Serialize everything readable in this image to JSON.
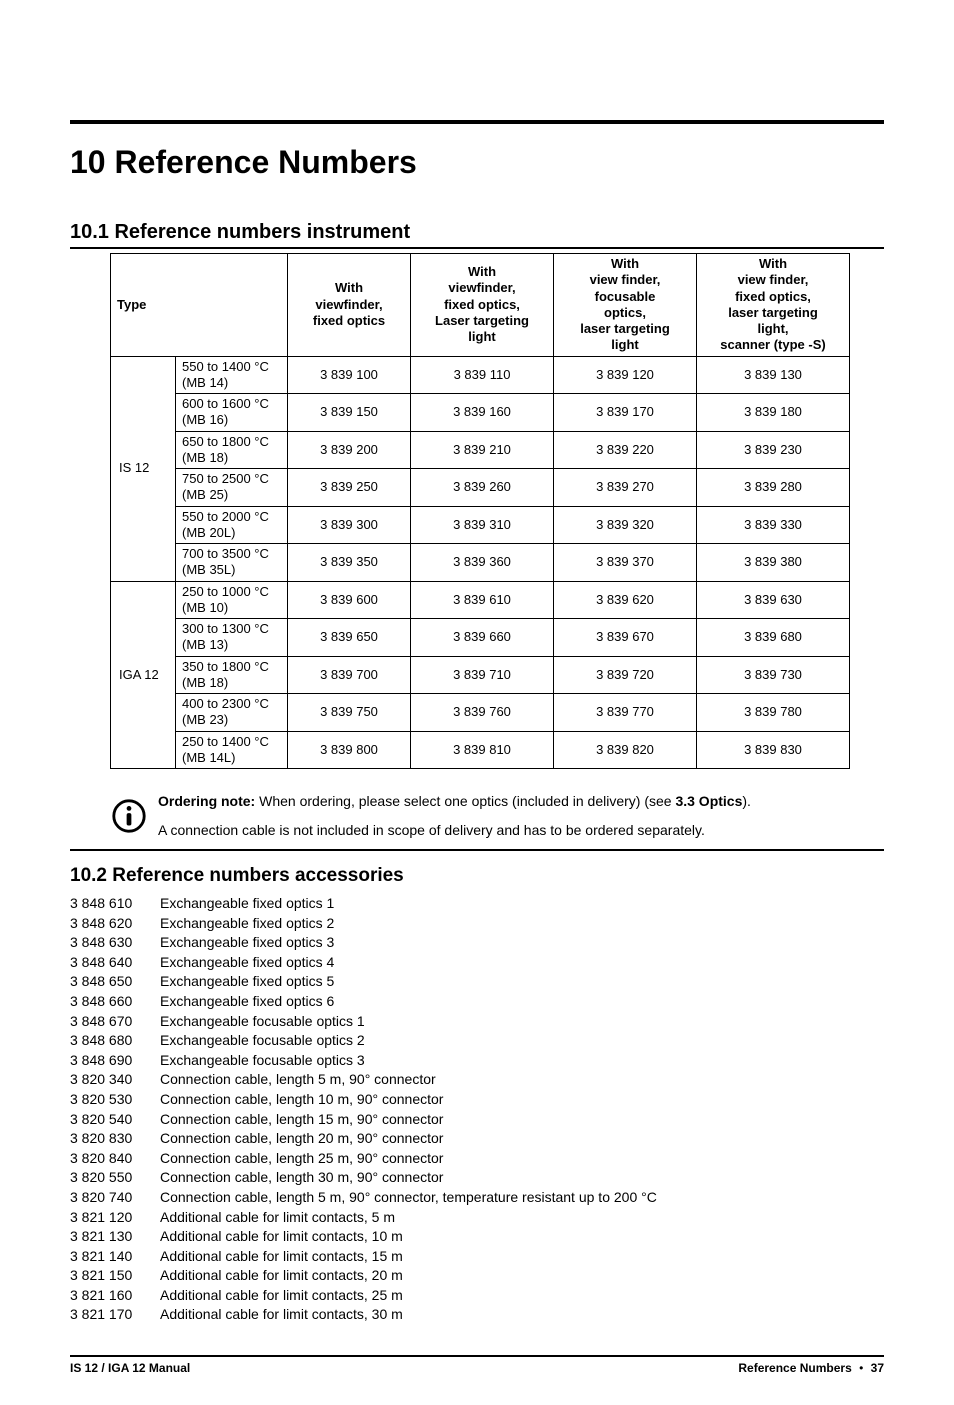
{
  "heading_main": "10  Reference Numbers",
  "section1_heading": "10.1  Reference numbers instrument",
  "table": {
    "headers": {
      "type": "Type",
      "col1": "With\nviewfinder,\nfixed optics",
      "col2": "With\nviewfinder,\nfixed optics,\nLaser targeting\nlight",
      "col3": "With\nview finder,\nfocusable\noptics,\nlaser targeting\nlight",
      "col4": "With\nview finder,\nfixed optics,\nlaser targeting\nlight,\nscanner (type -S)"
    },
    "groups": [
      {
        "label": "IS 12",
        "rows": [
          {
            "range": "550 to 1400 °C (MB 14)",
            "c1": "3 839 100",
            "c2": "3 839 110",
            "c3": "3 839 120",
            "c4": "3 839 130"
          },
          {
            "range": "600 to 1600 °C (MB 16)",
            "c1": "3 839 150",
            "c2": "3 839 160",
            "c3": "3 839 170",
            "c4": "3 839 180"
          },
          {
            "range": "650 to 1800 °C (MB 18)",
            "c1": "3 839 200",
            "c2": "3 839 210",
            "c3": "3 839 220",
            "c4": "3 839 230"
          },
          {
            "range": "750 to 2500 °C (MB 25)",
            "c1": "3 839 250",
            "c2": "3 839 260",
            "c3": "3 839 270",
            "c4": "3 839 280"
          },
          {
            "range": "550 to 2000 °C (MB 20L)",
            "c1": "3 839 300",
            "c2": "3 839 310",
            "c3": "3 839 320",
            "c4": "3 839 330"
          },
          {
            "range": "700 to 3500 °C (MB 35L)",
            "c1": "3 839 350",
            "c2": "3 839 360",
            "c3": "3 839 370",
            "c4": "3 839 380"
          }
        ]
      },
      {
        "label": "IGA 12",
        "rows": [
          {
            "range": "250 to 1000 °C (MB 10)",
            "c1": "3 839 600",
            "c2": "3 839 610",
            "c3": "3 839 620",
            "c4": "3 839 630"
          },
          {
            "range": "300 to 1300 °C (MB 13)",
            "c1": "3 839 650",
            "c2": "3 839 660",
            "c3": "3 839 670",
            "c4": "3 839 680"
          },
          {
            "range": "350 to 1800 °C (MB 18)",
            "c1": "3 839 700",
            "c2": "3 839 710",
            "c3": "3 839 720",
            "c4": "3 839 730"
          },
          {
            "range": "400 to 2300 °C (MB 23)",
            "c1": "3 839 750",
            "c2": "3 839 760",
            "c3": "3 839 770",
            "c4": "3 839 780"
          },
          {
            "range": "250 to 1400 °C (MB 14L)",
            "c1": "3 839 800",
            "c2": "3 839 810",
            "c3": "3 839 820",
            "c4": "3 839 830"
          }
        ]
      }
    ]
  },
  "note": {
    "title": "Ordering note:",
    "text1_a": "  When ordering, please select one optics (included in delivery) (see ",
    "text1_b": "3.3 Optics",
    "text1_c": ").",
    "text2": "A connection cable is not included in scope of delivery and has to be ordered separately."
  },
  "section2_heading": "10.2  Reference numbers accessories",
  "accessories": [
    {
      "code": "3 848 610",
      "desc": "Exchangeable fixed optics 1"
    },
    {
      "code": "3 848 620",
      "desc": "Exchangeable fixed optics 2"
    },
    {
      "code": "3 848 630",
      "desc": "Exchangeable fixed optics 3"
    },
    {
      "code": "3 848 640",
      "desc": "Exchangeable fixed optics 4"
    },
    {
      "code": "3 848 650",
      "desc": "Exchangeable fixed optics 5"
    },
    {
      "code": "3 848 660",
      "desc": "Exchangeable fixed optics 6"
    },
    {
      "code": "3 848 670",
      "desc": "Exchangeable focusable optics 1"
    },
    {
      "code": "3 848 680",
      "desc": "Exchangeable focusable optics 2"
    },
    {
      "code": "3 848 690",
      "desc": "Exchangeable focusable optics 3"
    },
    {
      "code": "3 820 340",
      "desc": "Connection cable, length 5 m, 90° connector"
    },
    {
      "code": "3 820 530",
      "desc": "Connection cable, length 10 m, 90° connector"
    },
    {
      "code": "3 820 540",
      "desc": "Connection cable, length 15 m, 90° connector"
    },
    {
      "code": "3 820 830",
      "desc": "Connection cable, length 20 m, 90° connector"
    },
    {
      "code": "3 820 840",
      "desc": "Connection cable, length 25 m, 90° connector"
    },
    {
      "code": "3 820 550",
      "desc": "Connection cable, length 30 m, 90° connector"
    },
    {
      "code": "3 820 740",
      "desc": "Connection cable, length 5 m, 90° connector, temperature resistant up to 200 °C"
    },
    {
      "code": "3 821 120",
      "desc": "Additional cable for limit contacts, 5 m"
    },
    {
      "code": "3 821 130",
      "desc": "Additional cable for limit contacts, 10 m"
    },
    {
      "code": "3 821 140",
      "desc": "Additional cable for limit contacts, 15 m"
    },
    {
      "code": "3 821 150",
      "desc": "Additional cable for limit contacts, 20 m"
    },
    {
      "code": "3 821 160",
      "desc": "Additional cable for limit contacts, 25 m"
    },
    {
      "code": "3 821 170",
      "desc": "Additional cable for limit contacts, 30 m"
    }
  ],
  "footer": {
    "left": "IS 12 / IGA 12 Manual",
    "right_label": "Reference Numbers",
    "bullet": "•",
    "page": "37"
  }
}
